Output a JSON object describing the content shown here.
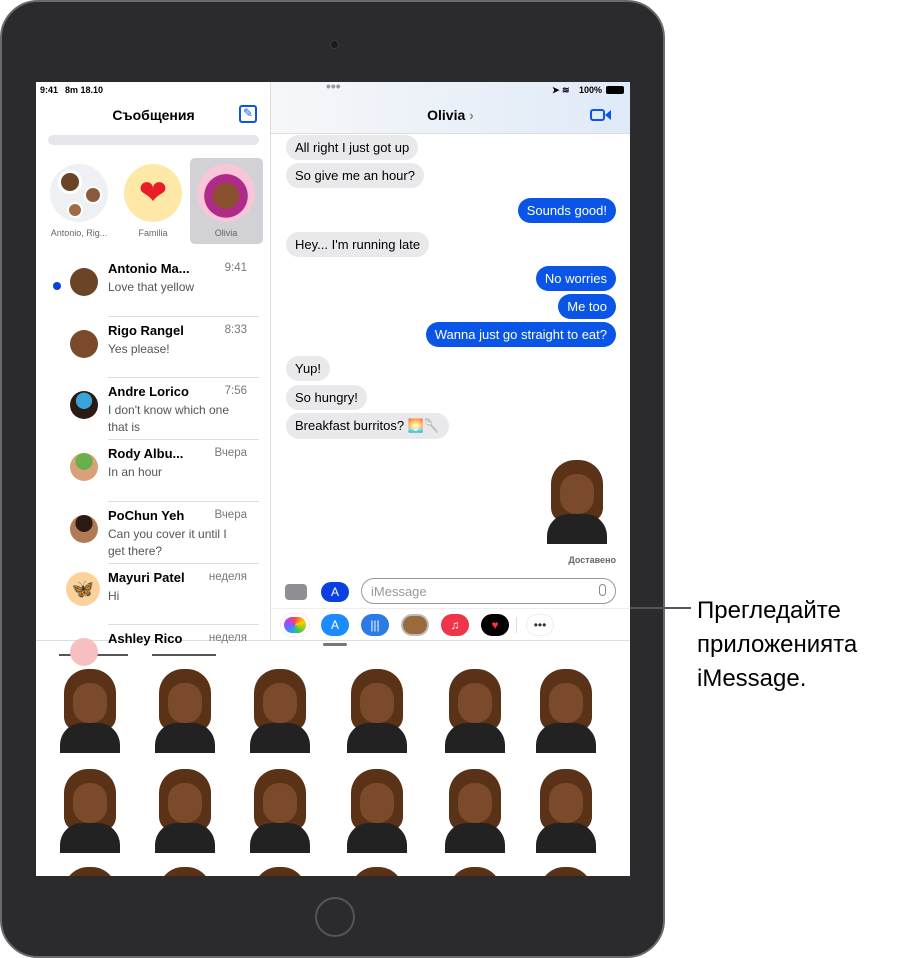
{
  "status_bar": {
    "time": "9:41",
    "date": "8m 18.10",
    "battery": "100%"
  },
  "sidebar": {
    "title": "Съобщения",
    "pinned": [
      {
        "label": "Antonio, Rig..."
      },
      {
        "label": "Familia"
      },
      {
        "label": "Olivia"
      }
    ],
    "conversations": [
      {
        "name": "Antonio Ma...",
        "time": "9:41",
        "preview": "Love that yellow",
        "unread": true
      },
      {
        "name": "Rigo Rangel",
        "time": "8:33",
        "preview": "Yes please!"
      },
      {
        "name": "Andre Lorico",
        "time": "7:56",
        "preview": "I don't know which one that is"
      },
      {
        "name": "Rody Albu...",
        "time": "Вчера",
        "preview": "In an hour"
      },
      {
        "name": "PoChun Yeh",
        "time": "Вчера",
        "preview": "Can you cover it until I get there?"
      },
      {
        "name": "Mayuri Patel",
        "time": "неделя",
        "preview": "Hi"
      },
      {
        "name": "Ashley Rico",
        "time": "неделя",
        "preview": ""
      }
    ]
  },
  "chat": {
    "contact": "Olivia",
    "chevron": "›",
    "messages": [
      {
        "dir": "in",
        "text": "All right I just got up"
      },
      {
        "dir": "in",
        "text": "So give me an hour?"
      },
      {
        "dir": "out",
        "text": "Sounds good!"
      },
      {
        "dir": "in",
        "text": "Hey... I'm running late"
      },
      {
        "dir": "out",
        "text": "No worries"
      },
      {
        "dir": "out",
        "text": "Me too"
      },
      {
        "dir": "out",
        "text": "Wanna just go straight to eat?"
      },
      {
        "dir": "in",
        "text": "Yup!"
      },
      {
        "dir": "in",
        "text": "So hungry!"
      },
      {
        "dir": "in",
        "text": "Breakfast burritos? 🌅🥄"
      }
    ],
    "delivered": "Доставено",
    "input_placeholder": "iMessage",
    "apps": [
      "photos-icon",
      "app-store-icon",
      "audio-icon",
      "memoji-icon",
      "music-icon",
      "fitness-icon",
      "more-icon"
    ]
  },
  "callout": {
    "text": "Прегледайте приложенията iMessage."
  },
  "colors": {
    "accent": "#0a55e8",
    "bubble_in": "#e9e9eb",
    "unread": "#0a3fe0"
  }
}
